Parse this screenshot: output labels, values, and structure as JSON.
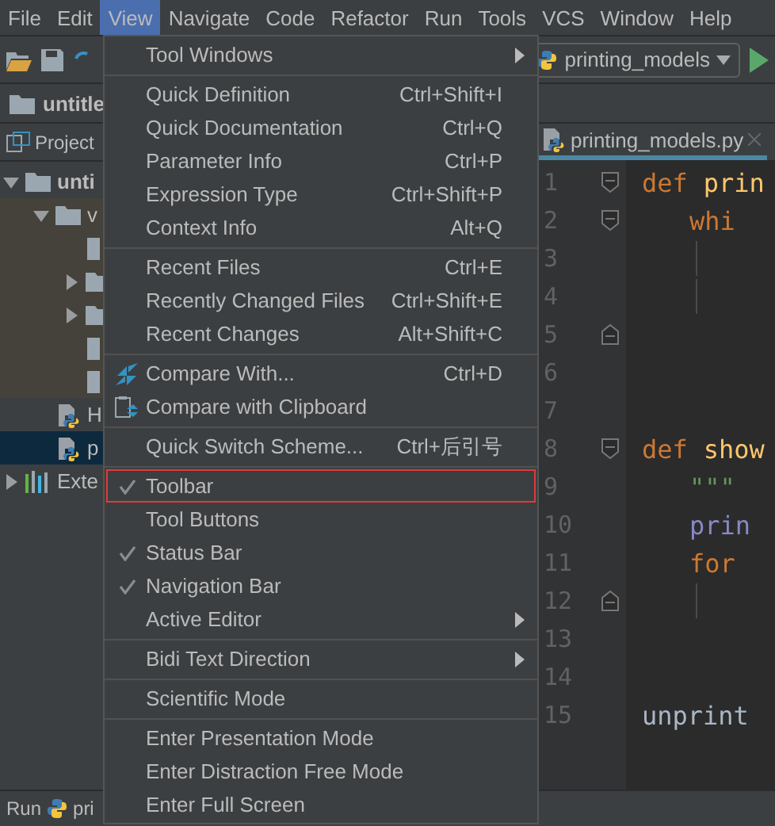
{
  "menubar": [
    {
      "label": "File",
      "selected": false
    },
    {
      "label": "Edit",
      "selected": false
    },
    {
      "label": "View",
      "selected": true
    },
    {
      "label": "Navigate",
      "selected": false
    },
    {
      "label": "Code",
      "selected": false
    },
    {
      "label": "Refactor",
      "selected": false
    },
    {
      "label": "Run",
      "selected": false
    },
    {
      "label": "Tools",
      "selected": false
    },
    {
      "label": "VCS",
      "selected": false
    },
    {
      "label": "Window",
      "selected": false
    },
    {
      "label": "Help",
      "selected": false
    }
  ],
  "toolbar": {
    "run_config": "printing_models"
  },
  "navbar": {
    "label": "untitle"
  },
  "project_panel": {
    "title": "Project",
    "tree": [
      {
        "label": "unti",
        "kind": "folder",
        "expanded": true,
        "selected": false,
        "children": [
          {
            "label": "v",
            "kind": "folder",
            "expanded": true,
            "selected": false,
            "children": [
              {
                "kind": "file",
                "selected": false
              },
              {
                "kind": "folder",
                "expanded": false,
                "selected": false
              },
              {
                "kind": "folder",
                "expanded": false,
                "selected": false
              },
              {
                "kind": "file",
                "selected": false
              },
              {
                "kind": "file",
                "selected": false
              }
            ]
          },
          {
            "label": "H",
            "kind": "python",
            "selected": false
          },
          {
            "label": "p",
            "kind": "python",
            "selected": true
          }
        ]
      },
      {
        "label": "Exte",
        "kind": "library",
        "expanded": false,
        "selected": false
      }
    ]
  },
  "editor": {
    "tab": "printing_models.py",
    "lines": [
      {
        "number": "1",
        "kind": "foldstart",
        "tokens": [
          {
            "text": "def",
            "kind": "keyword"
          },
          {
            "text": "prin",
            "kind": "function"
          }
        ],
        "children": [
          {
            "number": "2",
            "kind": "foldstart",
            "tokens": [
              {
                "text": "whi",
                "kind": "keyword"
              }
            ],
            "children": [
              {
                "number": "3",
                "kind": "plain",
                "guide": true
              },
              {
                "number": "4",
                "kind": "plain",
                "guide": true
              }
            ]
          }
        ]
      },
      {
        "number": "5",
        "kind": "foldend"
      },
      {
        "number": "6",
        "kind": "plain"
      },
      {
        "number": "7",
        "kind": "plain"
      },
      {
        "number": "8",
        "kind": "foldstart",
        "tokens": [
          {
            "text": "def",
            "kind": "keyword"
          },
          {
            "text": "show",
            "kind": "function"
          }
        ],
        "children": [
          {
            "number": "9",
            "kind": "plain",
            "tokens": [
              {
                "text": "\"\"\"",
                "kind": "docstring"
              }
            ]
          },
          {
            "number": "10",
            "kind": "plain",
            "tokens": [
              {
                "text": "prin",
                "kind": "builtin"
              }
            ]
          },
          {
            "number": "11",
            "kind": "plain",
            "tokens": [
              {
                "text": "for",
                "kind": "keyword"
              }
            ],
            "children": [
              {
                "number": "12",
                "kind": "foldend",
                "guide": true
              }
            ]
          }
        ]
      },
      {
        "number": "13",
        "kind": "plain"
      },
      {
        "number": "14",
        "kind": "plain"
      },
      {
        "number": "15",
        "kind": "plain",
        "tokens": [
          {
            "text": "unprint",
            "kind": "plain"
          }
        ]
      }
    ]
  },
  "run_bar": {
    "label": "Run",
    "config": "pri"
  },
  "view_menu": {
    "groups": [
      [
        {
          "label": "Tool Windows",
          "kind": "submenu",
          "checked": false,
          "highlighted": false
        }
      ],
      [
        {
          "label": "Quick Definition",
          "shortcut": "Ctrl+Shift+I",
          "kind": "item",
          "checked": false,
          "highlighted": false
        },
        {
          "label": "Quick Documentation",
          "shortcut": "Ctrl+Q",
          "kind": "item",
          "checked": false,
          "highlighted": false
        },
        {
          "label": "Parameter Info",
          "shortcut": "Ctrl+P",
          "kind": "item",
          "checked": false,
          "highlighted": false
        },
        {
          "label": "Expression Type",
          "shortcut": "Ctrl+Shift+P",
          "kind": "item",
          "checked": false,
          "highlighted": false
        },
        {
          "label": "Context Info",
          "shortcut": "Alt+Q",
          "kind": "item",
          "checked": false,
          "highlighted": false
        }
      ],
      [
        {
          "label": "Recent Files",
          "shortcut": "Ctrl+E",
          "kind": "item",
          "checked": false,
          "highlighted": false
        },
        {
          "label": "Recently Changed Files",
          "shortcut": "Ctrl+Shift+E",
          "kind": "item",
          "checked": false,
          "highlighted": false
        },
        {
          "label": "Recent Changes",
          "shortcut": "Alt+Shift+C",
          "kind": "item",
          "checked": false,
          "highlighted": false
        }
      ],
      [
        {
          "label": "Compare With...",
          "shortcut": "Ctrl+D",
          "kind": "compare",
          "checked": false,
          "highlighted": false
        },
        {
          "label": "Compare with Clipboard",
          "kind": "clipboard",
          "checked": false,
          "highlighted": false
        }
      ],
      [
        {
          "label": "Quick Switch Scheme...",
          "shortcut": "Ctrl+后引号",
          "kind": "item",
          "checked": false,
          "highlighted": false
        }
      ],
      [
        {
          "label": "Toolbar",
          "kind": "item",
          "checked": true,
          "highlighted": true
        },
        {
          "label": "Tool Buttons",
          "kind": "item",
          "checked": false,
          "highlighted": false
        },
        {
          "label": "Status Bar",
          "kind": "item",
          "checked": true,
          "highlighted": false
        },
        {
          "label": "Navigation Bar",
          "kind": "item",
          "checked": true,
          "highlighted": false
        },
        {
          "label": "Active Editor",
          "kind": "submenu",
          "checked": false,
          "highlighted": false
        }
      ],
      [
        {
          "label": "Bidi Text Direction",
          "kind": "submenu",
          "checked": false,
          "highlighted": false
        }
      ],
      [
        {
          "label": "Scientific Mode",
          "kind": "item",
          "checked": false,
          "highlighted": false
        }
      ],
      [
        {
          "label": "Enter Presentation Mode",
          "kind": "item",
          "checked": false,
          "highlighted": false
        },
        {
          "label": "Enter Distraction Free Mode",
          "kind": "item",
          "checked": false,
          "highlighted": false
        },
        {
          "label": "Enter Full Screen",
          "kind": "item",
          "checked": false,
          "highlighted": false
        }
      ]
    ]
  }
}
